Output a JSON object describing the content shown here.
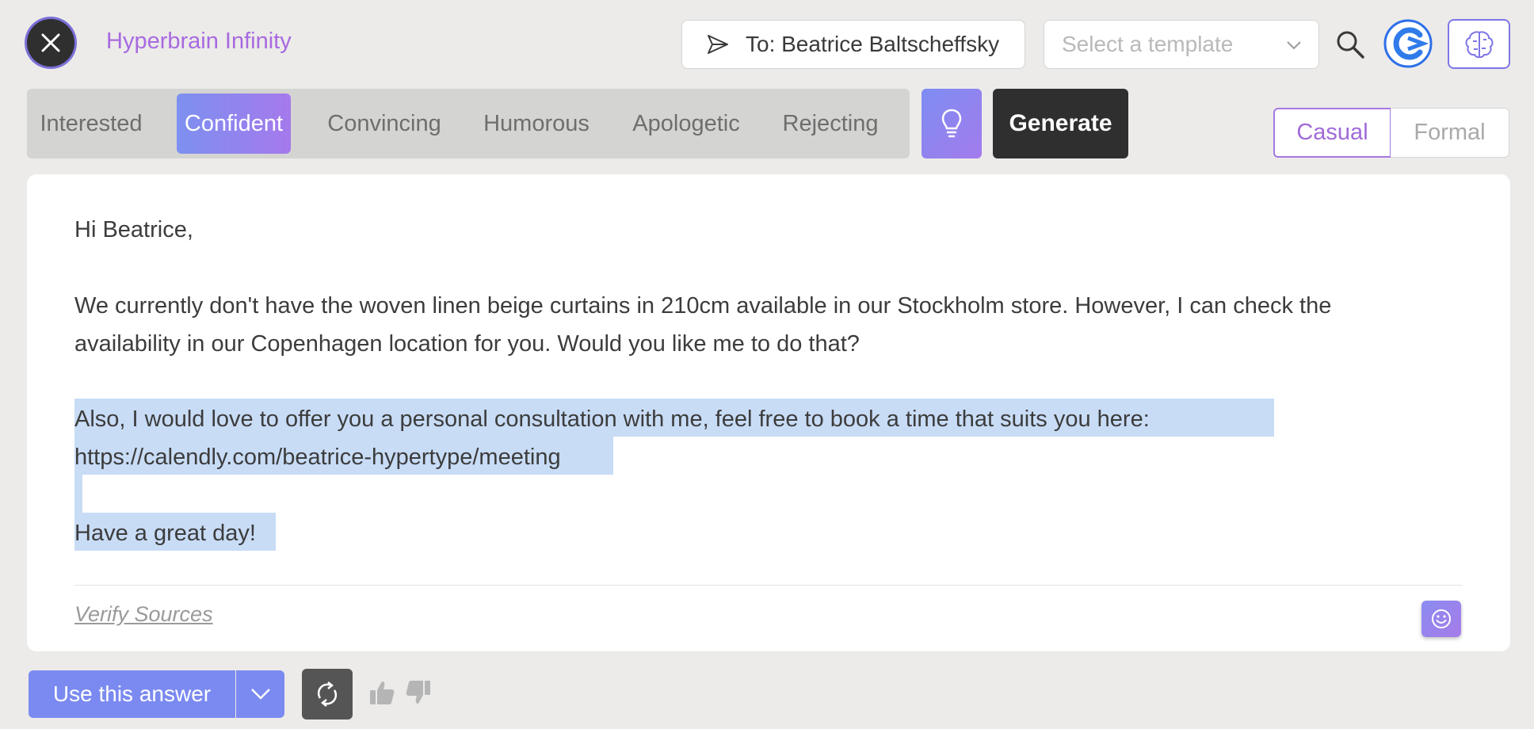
{
  "header": {
    "app_title": "Hyperbrain Infinity",
    "recipient": "To: Beatrice Baltscheffsky",
    "template_placeholder": "Select a template"
  },
  "tones": [
    {
      "label": "Interested",
      "active": false
    },
    {
      "label": "Confident",
      "active": true
    },
    {
      "label": "Convincing",
      "active": false
    },
    {
      "label": "Humorous",
      "active": false
    },
    {
      "label": "Apologetic",
      "active": false
    },
    {
      "label": "Rejecting",
      "active": false
    }
  ],
  "generate_label": "Generate",
  "style_toggle": {
    "casual": "Casual",
    "formal": "Formal",
    "selected": "Casual"
  },
  "email": {
    "greeting": "Hi Beatrice,",
    "body_line1": "We currently don't have the woven linen beige curtains in 210cm available in our Stockholm store. However, I can check the",
    "body_line2": "availability in our Copenhagen location for you. Would you like me to do that?",
    "offer_line1": "Also, I would love to offer you a personal consultation with me, feel free to book a time that suits you here:",
    "offer_line2": "https://calendly.com/beatrice-hypertype/meeting",
    "closing": "Have a great day!"
  },
  "verify_sources": "Verify Sources",
  "footer": {
    "use_answer": "Use this answer"
  },
  "colors": {
    "accent_purple": "#a86ae0",
    "accent_blue": "#7b8af0",
    "selection": "#c8dcf6",
    "dark": "#2f2f2f"
  },
  "icons": [
    "close-icon",
    "send-icon",
    "chevron-down-icon",
    "search-icon",
    "logo-icon",
    "brain-icon",
    "lightbulb-icon",
    "smile-icon",
    "refresh-icon",
    "thumbs-up-icon",
    "thumbs-down-icon"
  ]
}
